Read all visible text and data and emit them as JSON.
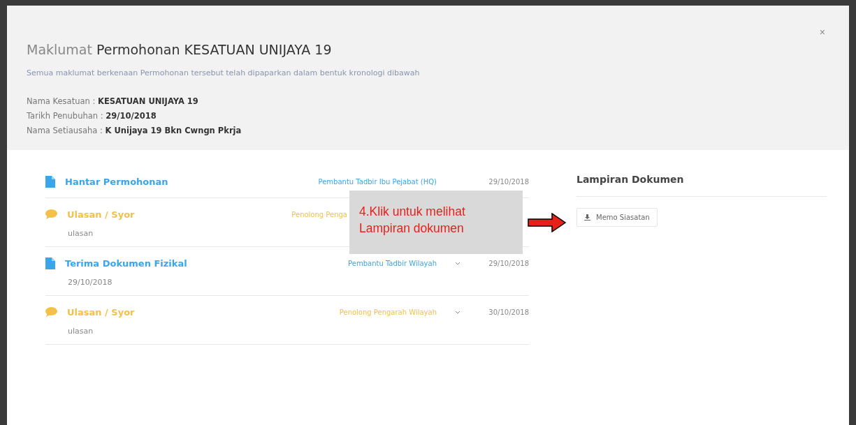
{
  "modal": {
    "title_prefix": "Maklumat",
    "title": "Permohonan KESATUAN UNIJAYA 19",
    "close": "×",
    "subtitle": "Semua maklumat berkenaan Permohonan tersebut telah dipaparkan dalam bentuk kronologi dibawah",
    "details": [
      {
        "label": "Nama Kesatuan :",
        "value": "KESATUAN UNIJAYA 19"
      },
      {
        "label": "Tarikh Penubuhan :",
        "value": "29/10/2018"
      },
      {
        "label": "Nama Setiausaha :",
        "value": "K Unijaya 19 Bkn Cwngn Pkrja"
      }
    ]
  },
  "timeline": [
    {
      "kind": "document",
      "title": "Hantar Permohonan",
      "by": "Pembantu Tadbir Ibu Pejabat (HQ)",
      "date": "29/10/2018",
      "chevron": false
    },
    {
      "kind": "comment",
      "title": "Ulasan / Syor",
      "by": "Penolong Penga",
      "note": "ulasan",
      "chevron": false
    },
    {
      "kind": "document",
      "title": "Terima Dokumen Fizikal",
      "by": "Pembantu Tadbir Wilayah",
      "date": "29/10/2018",
      "note": "29/10/2018",
      "chevron": true
    },
    {
      "kind": "comment",
      "title": "Ulasan / Syor",
      "by": "Penolong Pengarah Wilayah",
      "date": "30/10/2018",
      "note": "ulasan",
      "chevron": true
    }
  ],
  "attachments": {
    "heading": "Lampiran Dokumen",
    "buttons": [
      "Memo Siasatan"
    ]
  },
  "callout": {
    "lines": [
      "4.Klik untuk melihat",
      "Lampiran dokumen"
    ]
  }
}
